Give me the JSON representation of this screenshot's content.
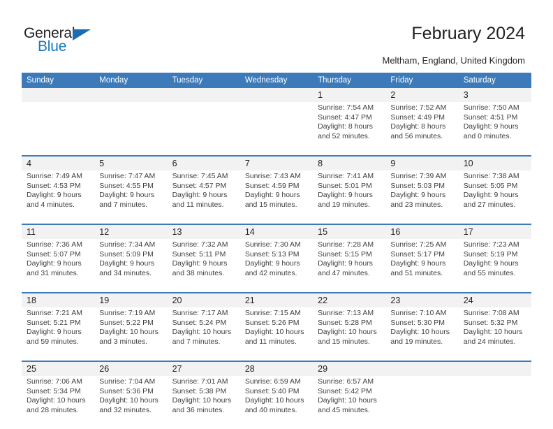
{
  "brand": {
    "name_part1": "General",
    "name_part2": "Blue",
    "accent_color": "#1878be",
    "triangle_color": "#1b6cb0"
  },
  "header": {
    "title": "February 2024",
    "location": "Meltham, England, United Kingdom",
    "header_bg_color": "#3c7ab9",
    "daynum_bg_color": "#f2f2f2"
  },
  "weekday_headers": [
    "Sunday",
    "Monday",
    "Tuesday",
    "Wednesday",
    "Thursday",
    "Friday",
    "Saturday"
  ],
  "labels": {
    "sunrise_prefix": "Sunrise:",
    "sunset_prefix": "Sunset:",
    "daylight_prefix": "Daylight:"
  },
  "weeks": [
    {
      "days": [
        {
          "num": "",
          "empty": true
        },
        {
          "num": "",
          "empty": true
        },
        {
          "num": "",
          "empty": true
        },
        {
          "num": "",
          "empty": true
        },
        {
          "num": "1",
          "sunrise": "Sunrise: 7:54 AM",
          "sunset": "Sunset: 4:47 PM",
          "daylight_1": "Daylight: 8 hours",
          "daylight_2": "and 52 minutes."
        },
        {
          "num": "2",
          "sunrise": "Sunrise: 7:52 AM",
          "sunset": "Sunset: 4:49 PM",
          "daylight_1": "Daylight: 8 hours",
          "daylight_2": "and 56 minutes."
        },
        {
          "num": "3",
          "sunrise": "Sunrise: 7:50 AM",
          "sunset": "Sunset: 4:51 PM",
          "daylight_1": "Daylight: 9 hours",
          "daylight_2": "and 0 minutes."
        }
      ]
    },
    {
      "days": [
        {
          "num": "4",
          "sunrise": "Sunrise: 7:49 AM",
          "sunset": "Sunset: 4:53 PM",
          "daylight_1": "Daylight: 9 hours",
          "daylight_2": "and 4 minutes."
        },
        {
          "num": "5",
          "sunrise": "Sunrise: 7:47 AM",
          "sunset": "Sunset: 4:55 PM",
          "daylight_1": "Daylight: 9 hours",
          "daylight_2": "and 7 minutes."
        },
        {
          "num": "6",
          "sunrise": "Sunrise: 7:45 AM",
          "sunset": "Sunset: 4:57 PM",
          "daylight_1": "Daylight: 9 hours",
          "daylight_2": "and 11 minutes."
        },
        {
          "num": "7",
          "sunrise": "Sunrise: 7:43 AM",
          "sunset": "Sunset: 4:59 PM",
          "daylight_1": "Daylight: 9 hours",
          "daylight_2": "and 15 minutes."
        },
        {
          "num": "8",
          "sunrise": "Sunrise: 7:41 AM",
          "sunset": "Sunset: 5:01 PM",
          "daylight_1": "Daylight: 9 hours",
          "daylight_2": "and 19 minutes."
        },
        {
          "num": "9",
          "sunrise": "Sunrise: 7:39 AM",
          "sunset": "Sunset: 5:03 PM",
          "daylight_1": "Daylight: 9 hours",
          "daylight_2": "and 23 minutes."
        },
        {
          "num": "10",
          "sunrise": "Sunrise: 7:38 AM",
          "sunset": "Sunset: 5:05 PM",
          "daylight_1": "Daylight: 9 hours",
          "daylight_2": "and 27 minutes."
        }
      ]
    },
    {
      "days": [
        {
          "num": "11",
          "sunrise": "Sunrise: 7:36 AM",
          "sunset": "Sunset: 5:07 PM",
          "daylight_1": "Daylight: 9 hours",
          "daylight_2": "and 31 minutes."
        },
        {
          "num": "12",
          "sunrise": "Sunrise: 7:34 AM",
          "sunset": "Sunset: 5:09 PM",
          "daylight_1": "Daylight: 9 hours",
          "daylight_2": "and 34 minutes."
        },
        {
          "num": "13",
          "sunrise": "Sunrise: 7:32 AM",
          "sunset": "Sunset: 5:11 PM",
          "daylight_1": "Daylight: 9 hours",
          "daylight_2": "and 38 minutes."
        },
        {
          "num": "14",
          "sunrise": "Sunrise: 7:30 AM",
          "sunset": "Sunset: 5:13 PM",
          "daylight_1": "Daylight: 9 hours",
          "daylight_2": "and 42 minutes."
        },
        {
          "num": "15",
          "sunrise": "Sunrise: 7:28 AM",
          "sunset": "Sunset: 5:15 PM",
          "daylight_1": "Daylight: 9 hours",
          "daylight_2": "and 47 minutes."
        },
        {
          "num": "16",
          "sunrise": "Sunrise: 7:25 AM",
          "sunset": "Sunset: 5:17 PM",
          "daylight_1": "Daylight: 9 hours",
          "daylight_2": "and 51 minutes."
        },
        {
          "num": "17",
          "sunrise": "Sunrise: 7:23 AM",
          "sunset": "Sunset: 5:19 PM",
          "daylight_1": "Daylight: 9 hours",
          "daylight_2": "and 55 minutes."
        }
      ]
    },
    {
      "days": [
        {
          "num": "18",
          "sunrise": "Sunrise: 7:21 AM",
          "sunset": "Sunset: 5:21 PM",
          "daylight_1": "Daylight: 9 hours",
          "daylight_2": "and 59 minutes."
        },
        {
          "num": "19",
          "sunrise": "Sunrise: 7:19 AM",
          "sunset": "Sunset: 5:22 PM",
          "daylight_1": "Daylight: 10 hours",
          "daylight_2": "and 3 minutes."
        },
        {
          "num": "20",
          "sunrise": "Sunrise: 7:17 AM",
          "sunset": "Sunset: 5:24 PM",
          "daylight_1": "Daylight: 10 hours",
          "daylight_2": "and 7 minutes."
        },
        {
          "num": "21",
          "sunrise": "Sunrise: 7:15 AM",
          "sunset": "Sunset: 5:26 PM",
          "daylight_1": "Daylight: 10 hours",
          "daylight_2": "and 11 minutes."
        },
        {
          "num": "22",
          "sunrise": "Sunrise: 7:13 AM",
          "sunset": "Sunset: 5:28 PM",
          "daylight_1": "Daylight: 10 hours",
          "daylight_2": "and 15 minutes."
        },
        {
          "num": "23",
          "sunrise": "Sunrise: 7:10 AM",
          "sunset": "Sunset: 5:30 PM",
          "daylight_1": "Daylight: 10 hours",
          "daylight_2": "and 19 minutes."
        },
        {
          "num": "24",
          "sunrise": "Sunrise: 7:08 AM",
          "sunset": "Sunset: 5:32 PM",
          "daylight_1": "Daylight: 10 hours",
          "daylight_2": "and 24 minutes."
        }
      ]
    },
    {
      "days": [
        {
          "num": "25",
          "sunrise": "Sunrise: 7:06 AM",
          "sunset": "Sunset: 5:34 PM",
          "daylight_1": "Daylight: 10 hours",
          "daylight_2": "and 28 minutes."
        },
        {
          "num": "26",
          "sunrise": "Sunrise: 7:04 AM",
          "sunset": "Sunset: 5:36 PM",
          "daylight_1": "Daylight: 10 hours",
          "daylight_2": "and 32 minutes."
        },
        {
          "num": "27",
          "sunrise": "Sunrise: 7:01 AM",
          "sunset": "Sunset: 5:38 PM",
          "daylight_1": "Daylight: 10 hours",
          "daylight_2": "and 36 minutes."
        },
        {
          "num": "28",
          "sunrise": "Sunrise: 6:59 AM",
          "sunset": "Sunset: 5:40 PM",
          "daylight_1": "Daylight: 10 hours",
          "daylight_2": "and 40 minutes."
        },
        {
          "num": "29",
          "sunrise": "Sunrise: 6:57 AM",
          "sunset": "Sunset: 5:42 PM",
          "daylight_1": "Daylight: 10 hours",
          "daylight_2": "and 45 minutes."
        },
        {
          "num": "",
          "empty": true
        },
        {
          "num": "",
          "empty": true
        }
      ]
    }
  ]
}
